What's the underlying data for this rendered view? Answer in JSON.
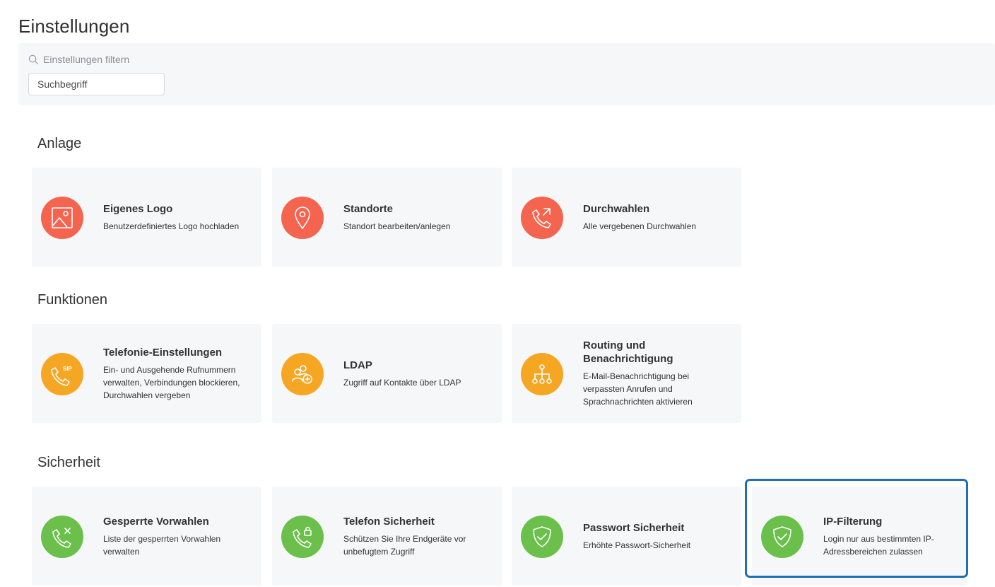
{
  "page": {
    "title": "Einstellungen"
  },
  "filter": {
    "label": "Einstellungen filtern",
    "placeholder": "Suchbegriff",
    "value": ""
  },
  "sections": [
    {
      "title": "Anlage",
      "cards": [
        {
          "title": "Eigenes Logo",
          "description": "Benutzerdefiniertes Logo hochladen",
          "icon": "image-icon",
          "color": "#f5644f"
        },
        {
          "title": "Standorte",
          "description": "Standort bearbeiten/anlegen",
          "icon": "location-pin-icon",
          "color": "#f5644f"
        },
        {
          "title": "Durchwahlen",
          "description": "Alle vergebenen Durchwahlen",
          "icon": "phone-forward-icon",
          "color": "#f5644f"
        }
      ]
    },
    {
      "title": "Funktionen",
      "cards": [
        {
          "title": "Telefonie-Einstellungen",
          "description": "Ein- und Ausgehende Rufnummern verwalten, Verbindungen blockieren, Durchwahlen vergeben",
          "icon": "sip-phone-icon",
          "icon_text": "SIP",
          "color": "#f5a623"
        },
        {
          "title": "LDAP",
          "description": "Zugriff auf Kontakte über LDAP",
          "icon": "contacts-add-icon",
          "color": "#f5a623"
        },
        {
          "title": "Routing und Benachrichtigung",
          "description": "E-Mail-Benachrichtigung bei verpassten Anrufen und Sprachnachrichten aktivieren",
          "icon": "routing-tree-icon",
          "color": "#f5a623"
        }
      ]
    },
    {
      "title": "Sicherheit",
      "cards": [
        {
          "title": "Gesperrte Vorwahlen",
          "description": "Liste der gesperrten Vorwahlen verwalten",
          "icon": "phone-blocked-icon",
          "color": "#6ac04b"
        },
        {
          "title": "Telefon Sicherheit",
          "description": "Schützen Sie Ihre Endgeräte vor unbefugtem Zugriff",
          "icon": "phone-lock-icon",
          "color": "#6ac04b"
        },
        {
          "title": "Passwort Sicherheit",
          "description": "Erhöhte Passwort-Sicherheit",
          "icon": "shield-check-icon",
          "color": "#6ac04b"
        },
        {
          "title": "IP-Filterung",
          "description": "Login nur aus bestimmten IP-Adressbereichen zulassen",
          "icon": "shield-check-icon",
          "color": "#6ac04b",
          "selected": true
        }
      ]
    }
  ]
}
